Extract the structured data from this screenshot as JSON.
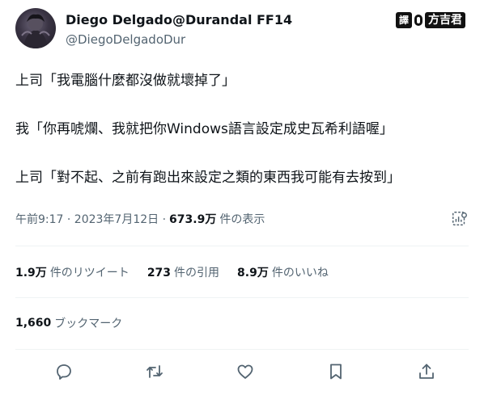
{
  "author": {
    "display_name": "Diego Delgado@Durandal FF14",
    "handle": "@DiegoDelgadoDur"
  },
  "watermark": {
    "badge": "譯",
    "text": "方吉君"
  },
  "tweet": {
    "lines": [
      "上司「我電腦什麼都沒做就壞掉了」",
      "我「你再唬爛、我就把你Windows語言設定成史瓦希利語喔」",
      "上司「對不起、之前有跑出來設定之類的東西我可能有去按到」"
    ]
  },
  "meta": {
    "timestamp": "午前9:17 · 2023年7月12日 ·",
    "views": "673.9万",
    "views_label": "件の表示"
  },
  "stats": {
    "retweets_count": "1.9万",
    "retweets_label": "件のリツイート",
    "quotes_count": "273",
    "quotes_label": "件の引用",
    "likes_count": "8.9万",
    "likes_label": "件のいいね"
  },
  "bookmarks": {
    "count": "1,660",
    "label": "ブックマーク"
  },
  "icons": {
    "reply": "reply-icon",
    "retweet": "retweet-icon",
    "like": "heart-icon",
    "bookmark": "bookmark-icon",
    "share": "share-icon",
    "analytics": "analytics-icon"
  },
  "colors": {
    "text": "#0f1419",
    "secondary": "#536471",
    "divider": "#eff3f4"
  }
}
